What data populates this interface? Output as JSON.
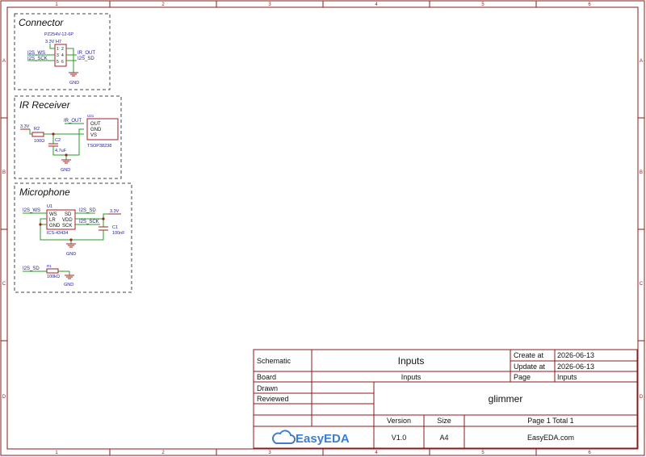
{
  "frame": {
    "columns": [
      "1",
      "2",
      "3",
      "4",
      "5",
      "6"
    ],
    "rows": [
      "A",
      "B",
      "C",
      "D"
    ]
  },
  "sections": {
    "connector": "Connector",
    "ir_receiver": "IR Receiver",
    "microphone": "Microphone"
  },
  "connector": {
    "part": "PZ254V-12-6P",
    "designator": "H7",
    "pins_left": [
      "1",
      "3",
      "5"
    ],
    "pins_right": [
      "2",
      "4",
      "6"
    ],
    "net_33v": "3.3V",
    "net_i2s_ws": "I2S_WS",
    "net_i2s_sck": "I2S_SCK",
    "net_ir_out": "IR_OUT",
    "net_i2s_sd": "I2S_SD",
    "gnd": "GND"
  },
  "ir": {
    "net_33v": "3.3V",
    "r2": "R2",
    "r2_value": "100Ω",
    "c2": "C2",
    "c2_value": "4.7uF",
    "net_ir_out": "IR_OUT",
    "u_ref": "U21",
    "pin_out": "OUT",
    "pin_gnd": "GND",
    "pin_vs": "VS",
    "part": "TSOP38238",
    "gnd": "GND"
  },
  "mic": {
    "u1": "U1",
    "net_i2s_ws": "I2S_WS",
    "net_i2s_sd": "I2S_SD",
    "net_i2s_sck": "I2S_SCK",
    "net_33v": "3.3V",
    "pin_ws": "WS",
    "pin_lr": "LR",
    "pin_gnd": "GND",
    "pin_sd": "SD",
    "pin_vdd": "VDD",
    "pin_sck": "SCK",
    "part": "ICS-43434",
    "c1": "C1",
    "c1_value": "100nF",
    "gnd": "GND",
    "r1_net": "I2S_SD",
    "r1": "R1",
    "r1_value": "100kΩ",
    "gnd2": "GND"
  },
  "title_block": {
    "schematic_label": "Schematic",
    "schematic_value": "Inputs",
    "create_label": "Create at",
    "create_value": "2026-06-13",
    "update_label": "Update at",
    "update_value": "2026-06-13",
    "board_label": "Board",
    "board_value": "Inputs",
    "page_label": "Page",
    "page_value": "Inputs",
    "drawn_label": "Drawn",
    "reviewed_label": "Reviewed",
    "project": "glimmer",
    "version_label": "Version",
    "version_value": "V1.0",
    "size_label": "Size",
    "size_value": "A4",
    "page_count": "Page  1  Total  1",
    "logo_text": "EasyEDA",
    "site": "EasyEDA.com"
  },
  "colors": {
    "frame": "#8b1a1a",
    "wire": "#2a9a2a",
    "net_label": "#1a1aa0",
    "symbol": "#a02020",
    "logo": "#3c7dd0"
  }
}
